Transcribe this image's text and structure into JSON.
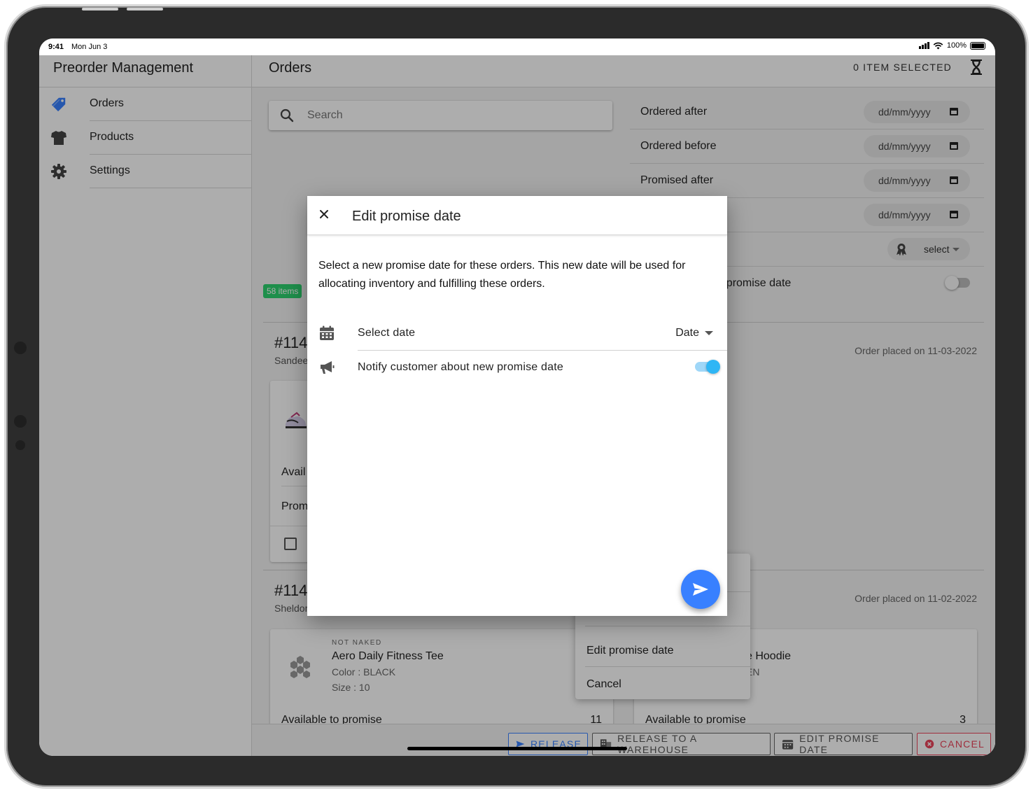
{
  "status_bar": {
    "time": "9:41",
    "date": "Mon Jun 3",
    "battery": "100%"
  },
  "sidebar": {
    "title": "Preorder Management",
    "items": [
      {
        "label": "Orders",
        "icon": "pricetag-icon",
        "color": "#3880ff"
      },
      {
        "label": "Products",
        "icon": "shirt-icon"
      },
      {
        "label": "Settings",
        "icon": "gear-icon"
      }
    ]
  },
  "header": {
    "title": "Orders",
    "selected": "0 ITEM SELECTED"
  },
  "search": {
    "placeholder": "Search"
  },
  "filters": [
    {
      "label": "Ordered after",
      "value": "dd/mm/yyyy"
    },
    {
      "label": "Ordered before",
      "value": "dd/mm/yyyy"
    },
    {
      "label": "Promised after",
      "value": "dd/mm/yyyy"
    },
    {
      "label": "",
      "value": "dd/mm/yyyy"
    }
  ],
  "filter_select": {
    "value": "select"
  },
  "filter_toggle": {
    "label": "ut promise date",
    "on": false
  },
  "items_badge": "58 items",
  "orders": [
    {
      "id": "#114",
      "customer": "Sandee",
      "placed": "Order placed on 11-03-2022",
      "available_label": "Avail",
      "promise_label": "Prom"
    },
    {
      "id": "#114",
      "customer": "Sheldor",
      "placed": "Order placed on 11-02-2022",
      "items": [
        {
          "brand": "NOT NAKED",
          "name": "Aero Daily Fitness Tee",
          "color": "Color : BLACK",
          "size": "Size : 10",
          "available_label": "Available to promise",
          "available_value": "11"
        },
        {
          "name": "e Hoodie",
          "color": "EN",
          "available_label": "Available to promise",
          "available_value": "3"
        }
      ]
    }
  ],
  "popover": {
    "edit": "Edit promise date",
    "cancel": "Cancel"
  },
  "footer": {
    "release": "RELEASE",
    "release_warehouse": "RELEASE TO A WAREHOUSE",
    "edit_promise": "EDIT PROMISE DATE",
    "cancel": "CANCEL"
  },
  "modal": {
    "title": "Edit promise date",
    "description": "Select a new promise date for these orders. This new date will be used for allocating inventory and fulfilling these orders.",
    "select_date_label": "Select date",
    "date_value": "Date",
    "notify_label": "Notify customer about new promise date",
    "notify_on": true
  },
  "colors": {
    "primary": "#3880ff",
    "success": "#2dd36f",
    "danger": "#eb445a",
    "toggle_on": "#2fb6f5"
  }
}
